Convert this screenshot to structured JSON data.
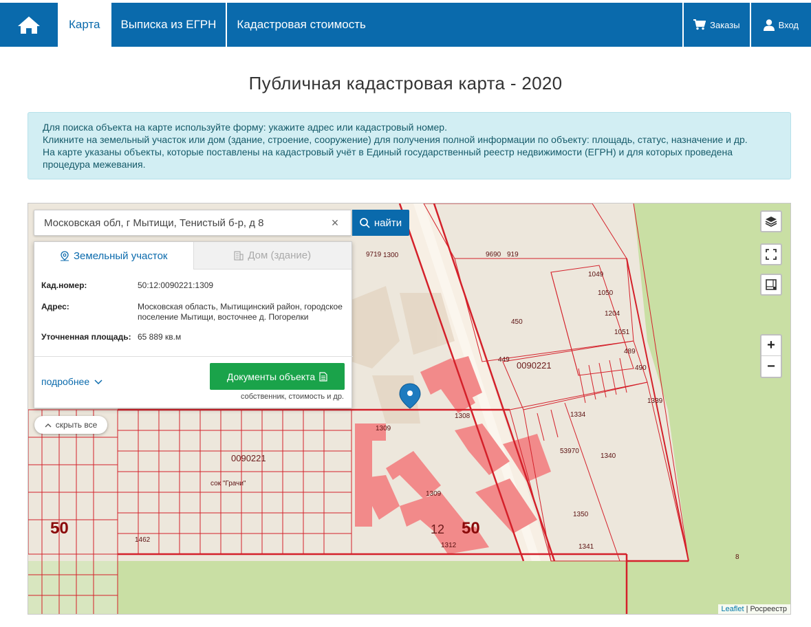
{
  "nav": {
    "tabs": [
      {
        "label": "Карта"
      },
      {
        "label": "Выписка из ЕГРН"
      },
      {
        "label": "Кадастровая стоимость"
      }
    ],
    "orders_label": "Заказы",
    "login_label": "Вход"
  },
  "page": {
    "title": "Публичная кадастровая карта - 2020"
  },
  "info": {
    "lines": [
      "Для поиска объекта на карте используйте форму: укажите адрес или кадастровый номер.",
      "Кликните на земельный участок или дом (здание, строение, сооружение) для получения полной информации по объекту: площадь, статус, назначение и др.",
      "На карте указаны объекты, которые поставлены на кадастровый учёт в Единый государственный реестр недвижимости (ЕГРН) и для которых проведена процедура межевания."
    ]
  },
  "search": {
    "value": "Московская обл, г Мытищи, Тенистый б-р, д 8",
    "button": "найти"
  },
  "panel": {
    "tab_land": "Земельный участок",
    "tab_house": "Дом (здание)",
    "rows": [
      {
        "key": "Кад.номер:",
        "value": "50:12:0090221:1309"
      },
      {
        "key": "Адрес:",
        "value": "Московская область, Мытищинский район, городское поселение Мытищи, восточнее д. Погорелки"
      },
      {
        "key": "Уточненная площадь:",
        "value": "65 889 кв.м"
      }
    ],
    "more": "подробнее",
    "docs_button": "Документы объекта",
    "docs_sub": "собственник, стоимость и др."
  },
  "map": {
    "hide_all": "скрыть все",
    "attribution_leaflet": "Leaflet",
    "attribution_source": "Росреестр",
    "labels": {
      "district_1": "0090221",
      "district_2": "0090221",
      "region_left": "50",
      "region_right": "50",
      "parcel_12": "12",
      "plot_1308": "1308",
      "plot_1309a": "1309",
      "plot_1309b": "1309",
      "plot_1312": "1312",
      "plot_1334": "1334",
      "plot_1341": "1341",
      "plot_450": "450",
      "plot_449": "449",
      "plot_9690": "9690",
      "plot_919": "919",
      "plot_9719": "9719",
      "plot_1300": "1300",
      "plot_1049": "1049",
      "plot_1050": "1050",
      "plot_1204": "1204",
      "plot_1051": "1051",
      "plot_489": "489",
      "plot_490": "490",
      "plot_1339": "1339",
      "plot_1340": "1340",
      "plot_53970": "53970",
      "plot_1350": "1350",
      "plot_1462": "1462",
      "plot_8": "8",
      "sok_name": "сок \"Грачи\""
    },
    "colors": {
      "boundary": "#d4202a",
      "building_fill": "#f28a8a",
      "green": "#c9dfa4",
      "base": "#ede7dc",
      "road": "#f7efe4"
    }
  }
}
